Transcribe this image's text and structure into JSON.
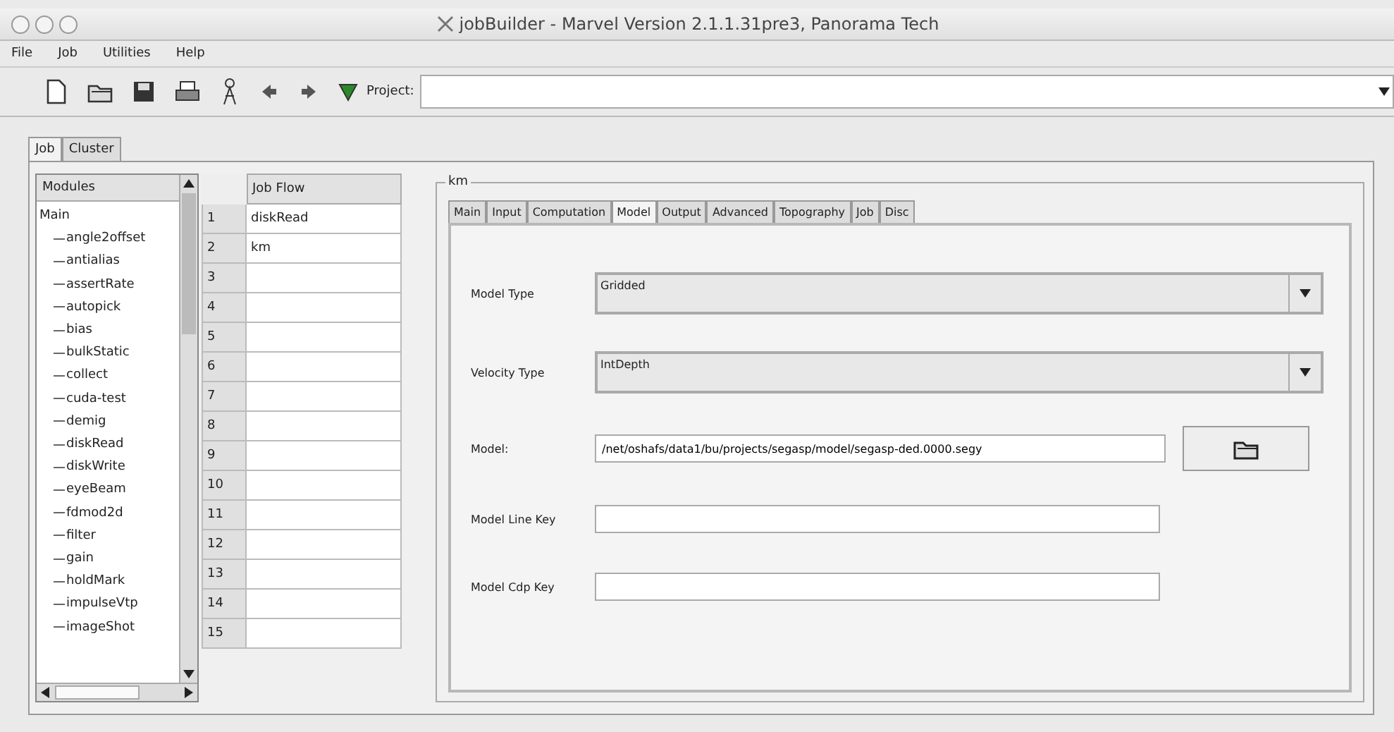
{
  "window": {
    "title": "jobBuilder - Marvel Version 2.1.1.31pre3, Panorama Tech"
  },
  "menu": [
    "File",
    "Job",
    "Utilities",
    "Help"
  ],
  "toolbar": {
    "project_label": "Project:"
  },
  "tabs": [
    {
      "label": "Job",
      "selected": true
    },
    {
      "label": "Cluster",
      "selected": false
    }
  ],
  "modules": {
    "header": "Modules",
    "tree": [
      {
        "label": "Main",
        "children": [
          {
            "label": "angle2offset"
          },
          {
            "label": "antialias"
          },
          {
            "label": "assertRate"
          },
          {
            "label": "autopick"
          },
          {
            "label": "bias"
          },
          {
            "label": "bulkStatic"
          },
          {
            "label": "collect"
          },
          {
            "label": "cuda-test"
          },
          {
            "label": "demig"
          },
          {
            "label": "diskRead"
          },
          {
            "label": "diskWrite"
          },
          {
            "label": "eyeBeam"
          },
          {
            "label": "fdmod2d"
          },
          {
            "label": "filter"
          },
          {
            "label": "gain"
          },
          {
            "label": "holdMark"
          },
          {
            "label": "impulseVtp"
          },
          {
            "label": "imageShot"
          }
        ]
      }
    ]
  },
  "job_flow": {
    "header": "Job Flow",
    "rows": [
      {
        "number": "1",
        "module": "diskRead"
      },
      {
        "number": "2",
        "module": "km"
      },
      {
        "number": "3"
      },
      {
        "number": "4"
      },
      {
        "number": "5"
      },
      {
        "number": "6"
      },
      {
        "number": "7"
      },
      {
        "number": "8"
      },
      {
        "number": "9"
      },
      {
        "number": "10"
      },
      {
        "number": "11"
      },
      {
        "number": "12"
      },
      {
        "number": "13"
      },
      {
        "number": "14"
      },
      {
        "number": "15"
      }
    ]
  },
  "module_panel": {
    "title": "km",
    "tabs": [
      {
        "label": "Main",
        "selected": false
      },
      {
        "label": "Input",
        "selected": false
      },
      {
        "label": "Computation",
        "selected": false
      },
      {
        "label": "Model",
        "selected": true
      },
      {
        "label": "Output",
        "selected": false
      },
      {
        "label": "Advanced",
        "selected": false
      },
      {
        "label": "Topography",
        "selected": false
      },
      {
        "label": "Job",
        "selected": false
      },
      {
        "label": "Disc",
        "selected": false
      }
    ],
    "fields": [
      {
        "kind": "dropdown",
        "label": "Model Type",
        "value": "Gridded"
      },
      {
        "kind": "dropdown",
        "label": "Velocity Type",
        "value": "IntDepth"
      },
      {
        "kind": "file",
        "label": "Model:",
        "value": "/net/oshafs/data1/bu/projects/segasp/model/segasp-ded.0000.segy"
      },
      {
        "kind": "text",
        "label": "Model Line Key"
      },
      {
        "kind": "text",
        "label": "Model Cdp Key"
      }
    ]
  }
}
